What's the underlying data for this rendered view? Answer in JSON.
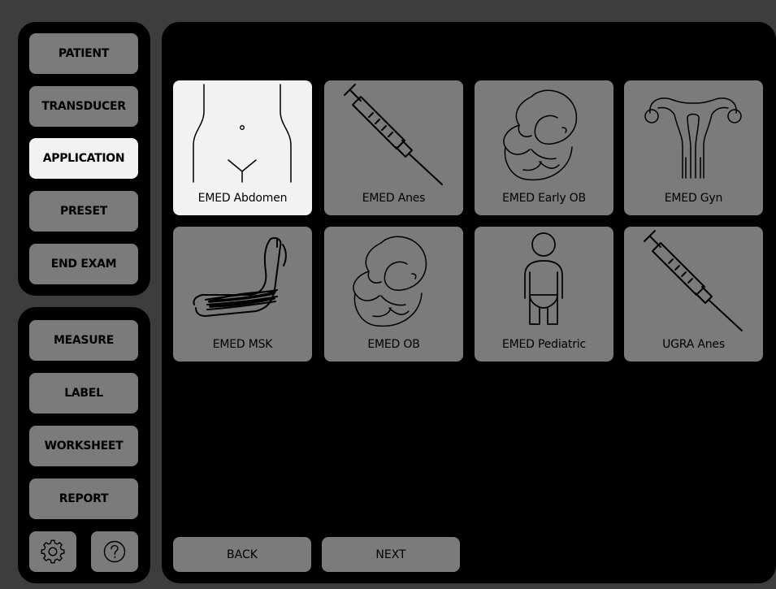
{
  "nav_top": {
    "patient": "PATIENT",
    "transducer": "TRANSDUCER",
    "application": "APPLICATION",
    "preset": "PRESET",
    "end_exam": "END EXAM"
  },
  "nav_bottom": {
    "measure": "MEASURE",
    "label": "LABEL",
    "worksheet": "WORKSHEET",
    "report": "REPORT"
  },
  "icons": {
    "settings": "gear-icon",
    "help": "help-icon"
  },
  "applications": [
    {
      "label": "EMED Abdomen",
      "icon": "abdomen-icon",
      "selected": true
    },
    {
      "label": "EMED Anes",
      "icon": "syringe-icon",
      "selected": false
    },
    {
      "label": "EMED Early OB",
      "icon": "fetus-icon",
      "selected": false
    },
    {
      "label": "EMED Gyn",
      "icon": "uterus-icon",
      "selected": false
    },
    {
      "label": "EMED MSK",
      "icon": "arm-muscle-icon",
      "selected": false
    },
    {
      "label": "EMED OB",
      "icon": "fetus-icon",
      "selected": false
    },
    {
      "label": "EMED Pediatric",
      "icon": "child-icon",
      "selected": false
    },
    {
      "label": "UGRA Anes",
      "icon": "syringe-icon",
      "selected": false
    }
  ],
  "footer": {
    "back": "BACK",
    "next": "NEXT"
  },
  "colors": {
    "background": "#3d3d3d",
    "panel": "#000000",
    "button": "#7b7b7b",
    "selected": "#f2f2f2"
  }
}
